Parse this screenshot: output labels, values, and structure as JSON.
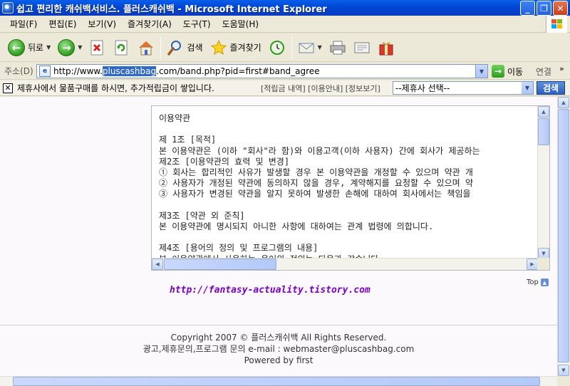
{
  "window": {
    "title": "쉽고 편리한 캐쉬백서비스. 플러스캐쉬백 - Microsoft Internet Explorer"
  },
  "menu": [
    "파일(F)",
    "편집(E)",
    "보기(V)",
    "즐겨찾기(A)",
    "도구(T)",
    "도움말(H)"
  ],
  "toolbar": {
    "back_label": "뒤로",
    "search_label": "검색",
    "favorites_label": "즐겨찾기"
  },
  "address": {
    "label": "주소(D)",
    "url_prefix": "http://www.",
    "url_highlight": "pluscashbag",
    "url_suffix": ".com/band.php?pid=first#band_agree",
    "go_label": "이동",
    "links_label": "연결",
    "more": "»"
  },
  "infobar": {
    "message": "제휴사에서 물품구매를 하시면, 추가적립금이 쌓입니다.",
    "links": "[적립금 내역] [이용안내] [정보보기]",
    "select_value": "--제휴사 선택--",
    "search_button": "검색"
  },
  "terms": {
    "lines": [
      "이용약관",
      "",
      "제 1조 [목적]",
      "본 이용약관은 (이하 \"회사\"라 함)와 이용고객(이하 사용자) 간에 회사가 제공하는",
      "제2조 [이용약관의 효력 및 변경]",
      "① 회사는 합리적인 사유가 발생할 경우 본 이용약관을 개정할 수 있으며 약관 개",
      "② 사용자가 개정된 약관에 동의하지 않을 경우, 계약해지를 요청할 수 있으며 약",
      "③ 사용자가 변경된 약관을 알지 못하여 발생한 손해에 대하여 회사에서는 책임을",
      "",
      "제3조 [약관 외 준칙]",
      "본 이용약관에 명시되지 아니한 사항에 대하여는 관계 법령에 의합니다.",
      "",
      "제4조 [용어의 정의 및 프로그램의 내용]",
      "본 이용약관에서 사용하는 용어의 정의는 다음과 같습니다."
    ]
  },
  "signature_url": "http://fantasy-actuality.tistory.com",
  "top_link": "Top",
  "footer": {
    "copyright": "Copyright 2007 © 플러스캐쉬백 All Rights Reserved.",
    "contact": "광고,제휴문의,프로그램 문의 e-mail : webmaster@pluscashbag.com",
    "powered": "Powered by first"
  }
}
